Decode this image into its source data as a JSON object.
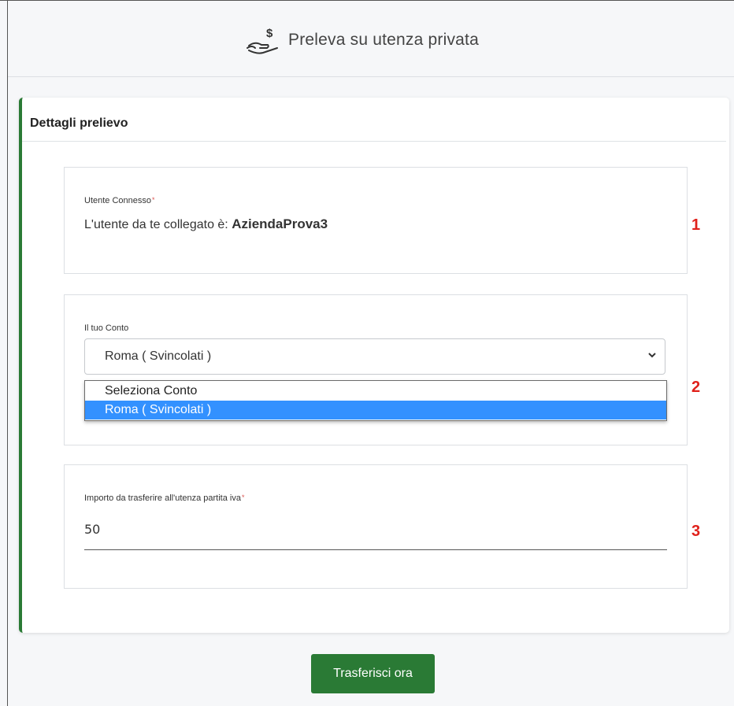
{
  "header": {
    "title": "Preleva su utenza privata",
    "icon": "hand-dollar-icon"
  },
  "card": {
    "title": "Dettagli prelievo"
  },
  "user_section": {
    "label": "Utente Connesso",
    "required_mark": "*",
    "text_prefix": "L'utente da te collegato è: ",
    "username": "AziendaProva3"
  },
  "account_section": {
    "label": "Il tuo Conto",
    "selected": "Roma ( Svincolati )",
    "options": [
      "Seleziona Conto",
      "Roma ( Svincolati )"
    ]
  },
  "amount_section": {
    "label": "Importo da trasferire all'utenza partita iva",
    "required_mark": "*",
    "value": "50"
  },
  "markers": [
    "1",
    "2",
    "3"
  ],
  "submit": {
    "label": "Trasferisci ora"
  },
  "colors": {
    "accent_green": "#2a7a35",
    "option_highlight": "#3391ff",
    "marker_red": "#e0211b"
  }
}
